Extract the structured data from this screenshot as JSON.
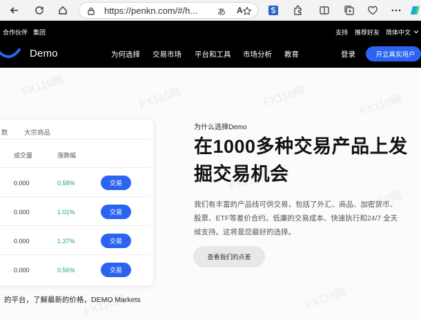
{
  "browser": {
    "url": "https://penkn.com/#/h...",
    "read_aloud_label": "A",
    "translate_label": "あ"
  },
  "site": {
    "topbar": {
      "partner": "合作伙伴",
      "group": "集团",
      "support": "支持",
      "refer": "推荐好友",
      "language": "简体中文"
    },
    "logo_text": "Demo",
    "nav": [
      "为何选择",
      "交易市场",
      "平台和工具",
      "市场分析",
      "教育"
    ],
    "login": "登录",
    "open_account": "开立真实用户"
  },
  "market_card": {
    "tabs": [
      "数",
      "大宗商品"
    ],
    "columns": [
      "成交量",
      "涨跌幅"
    ],
    "rows": [
      {
        "volume": "0.000",
        "change": "0.58%",
        "action": "交易"
      },
      {
        "volume": "0.000",
        "change": "1.01%",
        "action": "交易"
      },
      {
        "volume": "0.000",
        "change": "1.37%",
        "action": "交易"
      },
      {
        "volume": "0.000",
        "change": "0.56%",
        "action": "交易"
      }
    ],
    "note": "的平台，了解最新的价格，DEMO Markets"
  },
  "hero": {
    "label": "为什么选择Demo",
    "headline": "在1000多种交易产品上发掘交易机会",
    "description": "我们有丰富的产品线可供交易，包括了外汇、商品、加密货币、股票、ETF等差价合约。低廉的交易成本、快速执行和24/7 全天候支持。这将是您最好的选择。",
    "cta": "查看我们的点差"
  },
  "watermark": "FX110网",
  "colors": {
    "accent": "#2a64f0",
    "positive": "#1ba37a",
    "header_bg": "#000000"
  }
}
